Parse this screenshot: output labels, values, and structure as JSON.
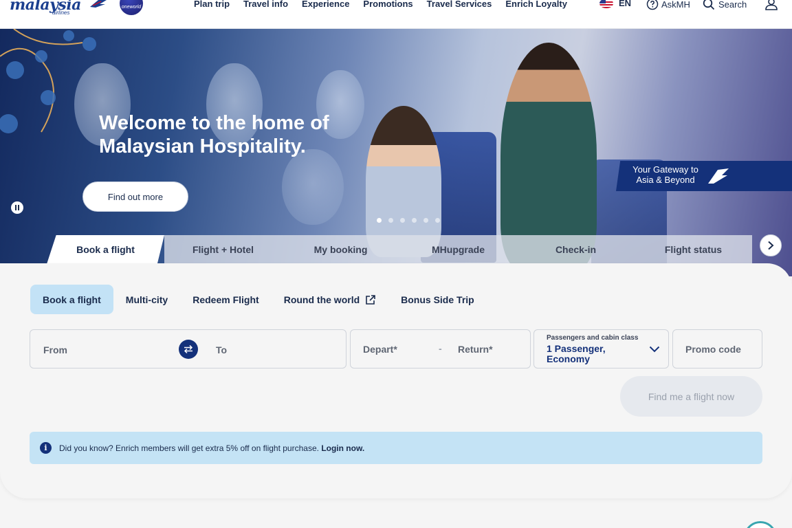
{
  "header": {
    "logo_text": "malaysia",
    "logo_sub": "airlines",
    "oneworld_label": "oneworld",
    "nav": [
      "Plan trip",
      "Travel info",
      "Experience",
      "Promotions",
      "Travel Services",
      "Enrich Loyalty"
    ],
    "lang": "EN",
    "askmh": "AskMH",
    "search": "Search"
  },
  "hero": {
    "title_line1": "Welcome to the home of",
    "title_line2": "Malaysian Hospitality.",
    "cta": "Find out more",
    "gateway_line1": "Your Gateway to",
    "gateway_line2": "Asia & Beyond"
  },
  "tabs": [
    "Book a flight",
    "Flight + Hotel",
    "My booking",
    "MHupgrade",
    "Check-in",
    "Flight status"
  ],
  "subtabs": [
    "Book a flight",
    "Multi-city",
    "Redeem Flight",
    "Round the world",
    "Bonus Side Trip"
  ],
  "form": {
    "from": "From",
    "to": "To",
    "depart": "Depart*",
    "dash": "-",
    "return": "Return*",
    "pax_label": "Passengers and cabin class",
    "pax_value": "1 Passenger, Economy",
    "promo": "Promo code",
    "submit": "Find me a flight now"
  },
  "info": {
    "text": "Did you know? Enrich members will get extra 5% off on flight purchase.",
    "link": "Login now."
  },
  "colors": {
    "brand_navy": "#14317a",
    "active_subtab": "#c3e2f6",
    "info_bg": "#c4e3f5"
  }
}
